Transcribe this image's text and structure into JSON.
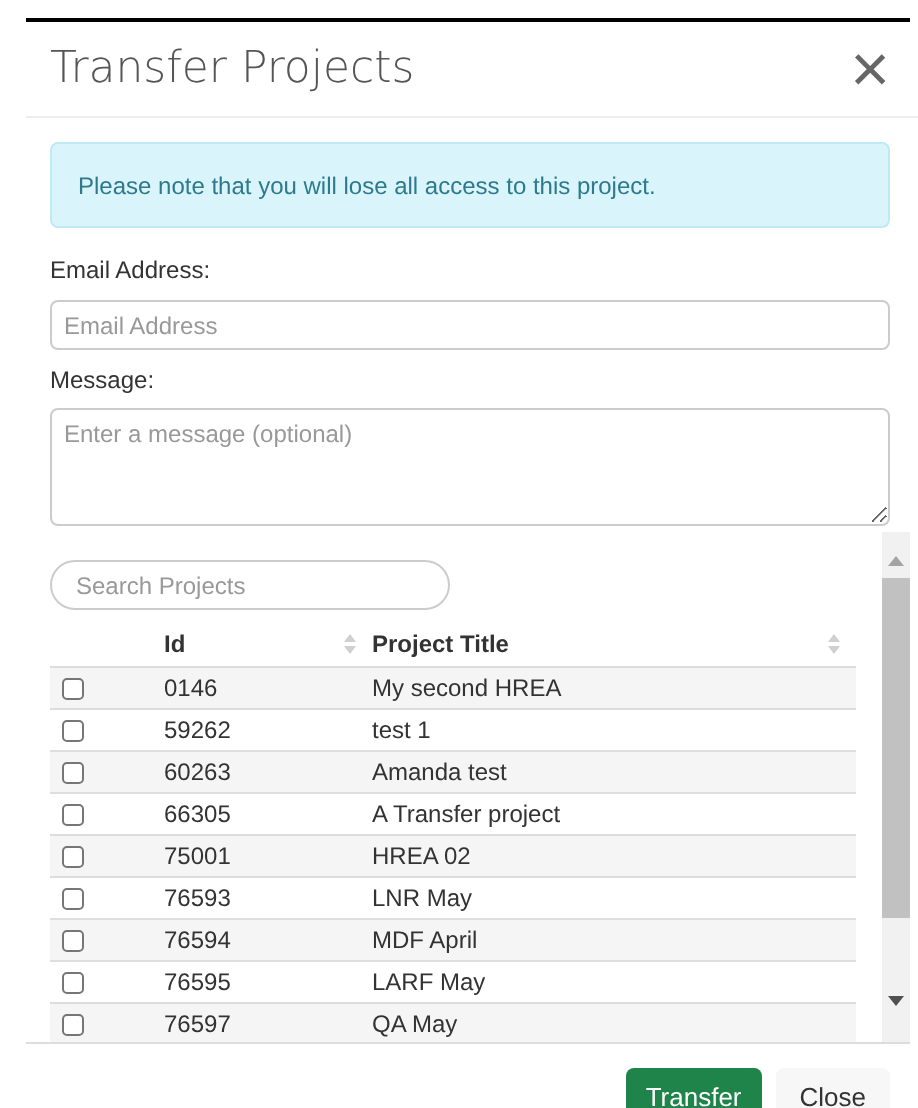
{
  "dialog": {
    "title": "Transfer Projects",
    "close_glyph": "×"
  },
  "alert": "Please note that you will lose all access to this project.",
  "email": {
    "label": "Email Address:",
    "placeholder": "Email Address"
  },
  "message": {
    "label": "Message:",
    "placeholder": "Enter a message (optional)"
  },
  "search": {
    "placeholder": "Search Projects"
  },
  "table": {
    "columns": [
      "Id",
      "Project Title"
    ],
    "rows": [
      {
        "id": "0146",
        "title": "My second HREA",
        "checked": false
      },
      {
        "id": "59262",
        "title": "test 1",
        "checked": false
      },
      {
        "id": "60263",
        "title": "Amanda test",
        "checked": false
      },
      {
        "id": "66305",
        "title": "A Transfer project",
        "checked": false
      },
      {
        "id": "75001",
        "title": "HREA 02",
        "checked": false
      },
      {
        "id": "76593",
        "title": "LNR May",
        "checked": false
      },
      {
        "id": "76594",
        "title": "MDF April",
        "checked": false
      },
      {
        "id": "76595",
        "title": "LARF May",
        "checked": false
      },
      {
        "id": "76597",
        "title": "QA May",
        "checked": false
      }
    ]
  },
  "buttons": [
    "Transfer",
    "Close"
  ]
}
